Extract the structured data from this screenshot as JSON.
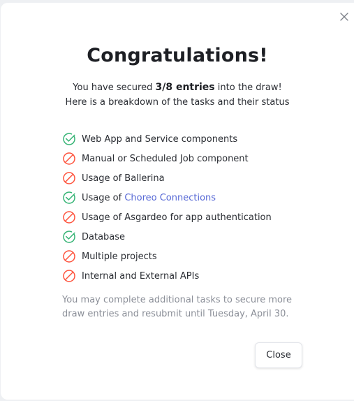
{
  "dialog": {
    "title": "Congratulations!",
    "summary": {
      "prefix": "You have secured",
      "entries": "3/8 entries",
      "suffix": "into the draw!",
      "line2": "Here is a breakdown of the tasks and their status"
    },
    "tasks": [
      {
        "label": "Web App and Service components",
        "status": "done",
        "icon": "check-circle-icon"
      },
      {
        "label": "Manual or Scheduled Job component",
        "status": "not-done",
        "icon": "prohibited-icon"
      },
      {
        "label": "Usage of Ballerina",
        "status": "not-done",
        "icon": "prohibited-icon"
      },
      {
        "label_prefix": "Usage of",
        "link": "Choreo Connections",
        "status": "done",
        "icon": "check-circle-icon"
      },
      {
        "label": "Usage of Asgardeo for app authentication",
        "status": "not-done",
        "icon": "prohibited-icon"
      },
      {
        "label": "Database",
        "status": "done",
        "icon": "check-circle-icon"
      },
      {
        "label": "Multiple projects",
        "status": "not-done",
        "icon": "prohibited-icon"
      },
      {
        "label": "Internal and External APIs",
        "status": "not-done",
        "icon": "prohibited-icon"
      }
    ],
    "note": "You may complete additional tasks to secure more draw entries and resubmit until Tuesday, April 30.",
    "close_label": "Close"
  },
  "colors": {
    "done": "#36b475",
    "not_done": "#fe523c",
    "link": "#5567d5"
  }
}
